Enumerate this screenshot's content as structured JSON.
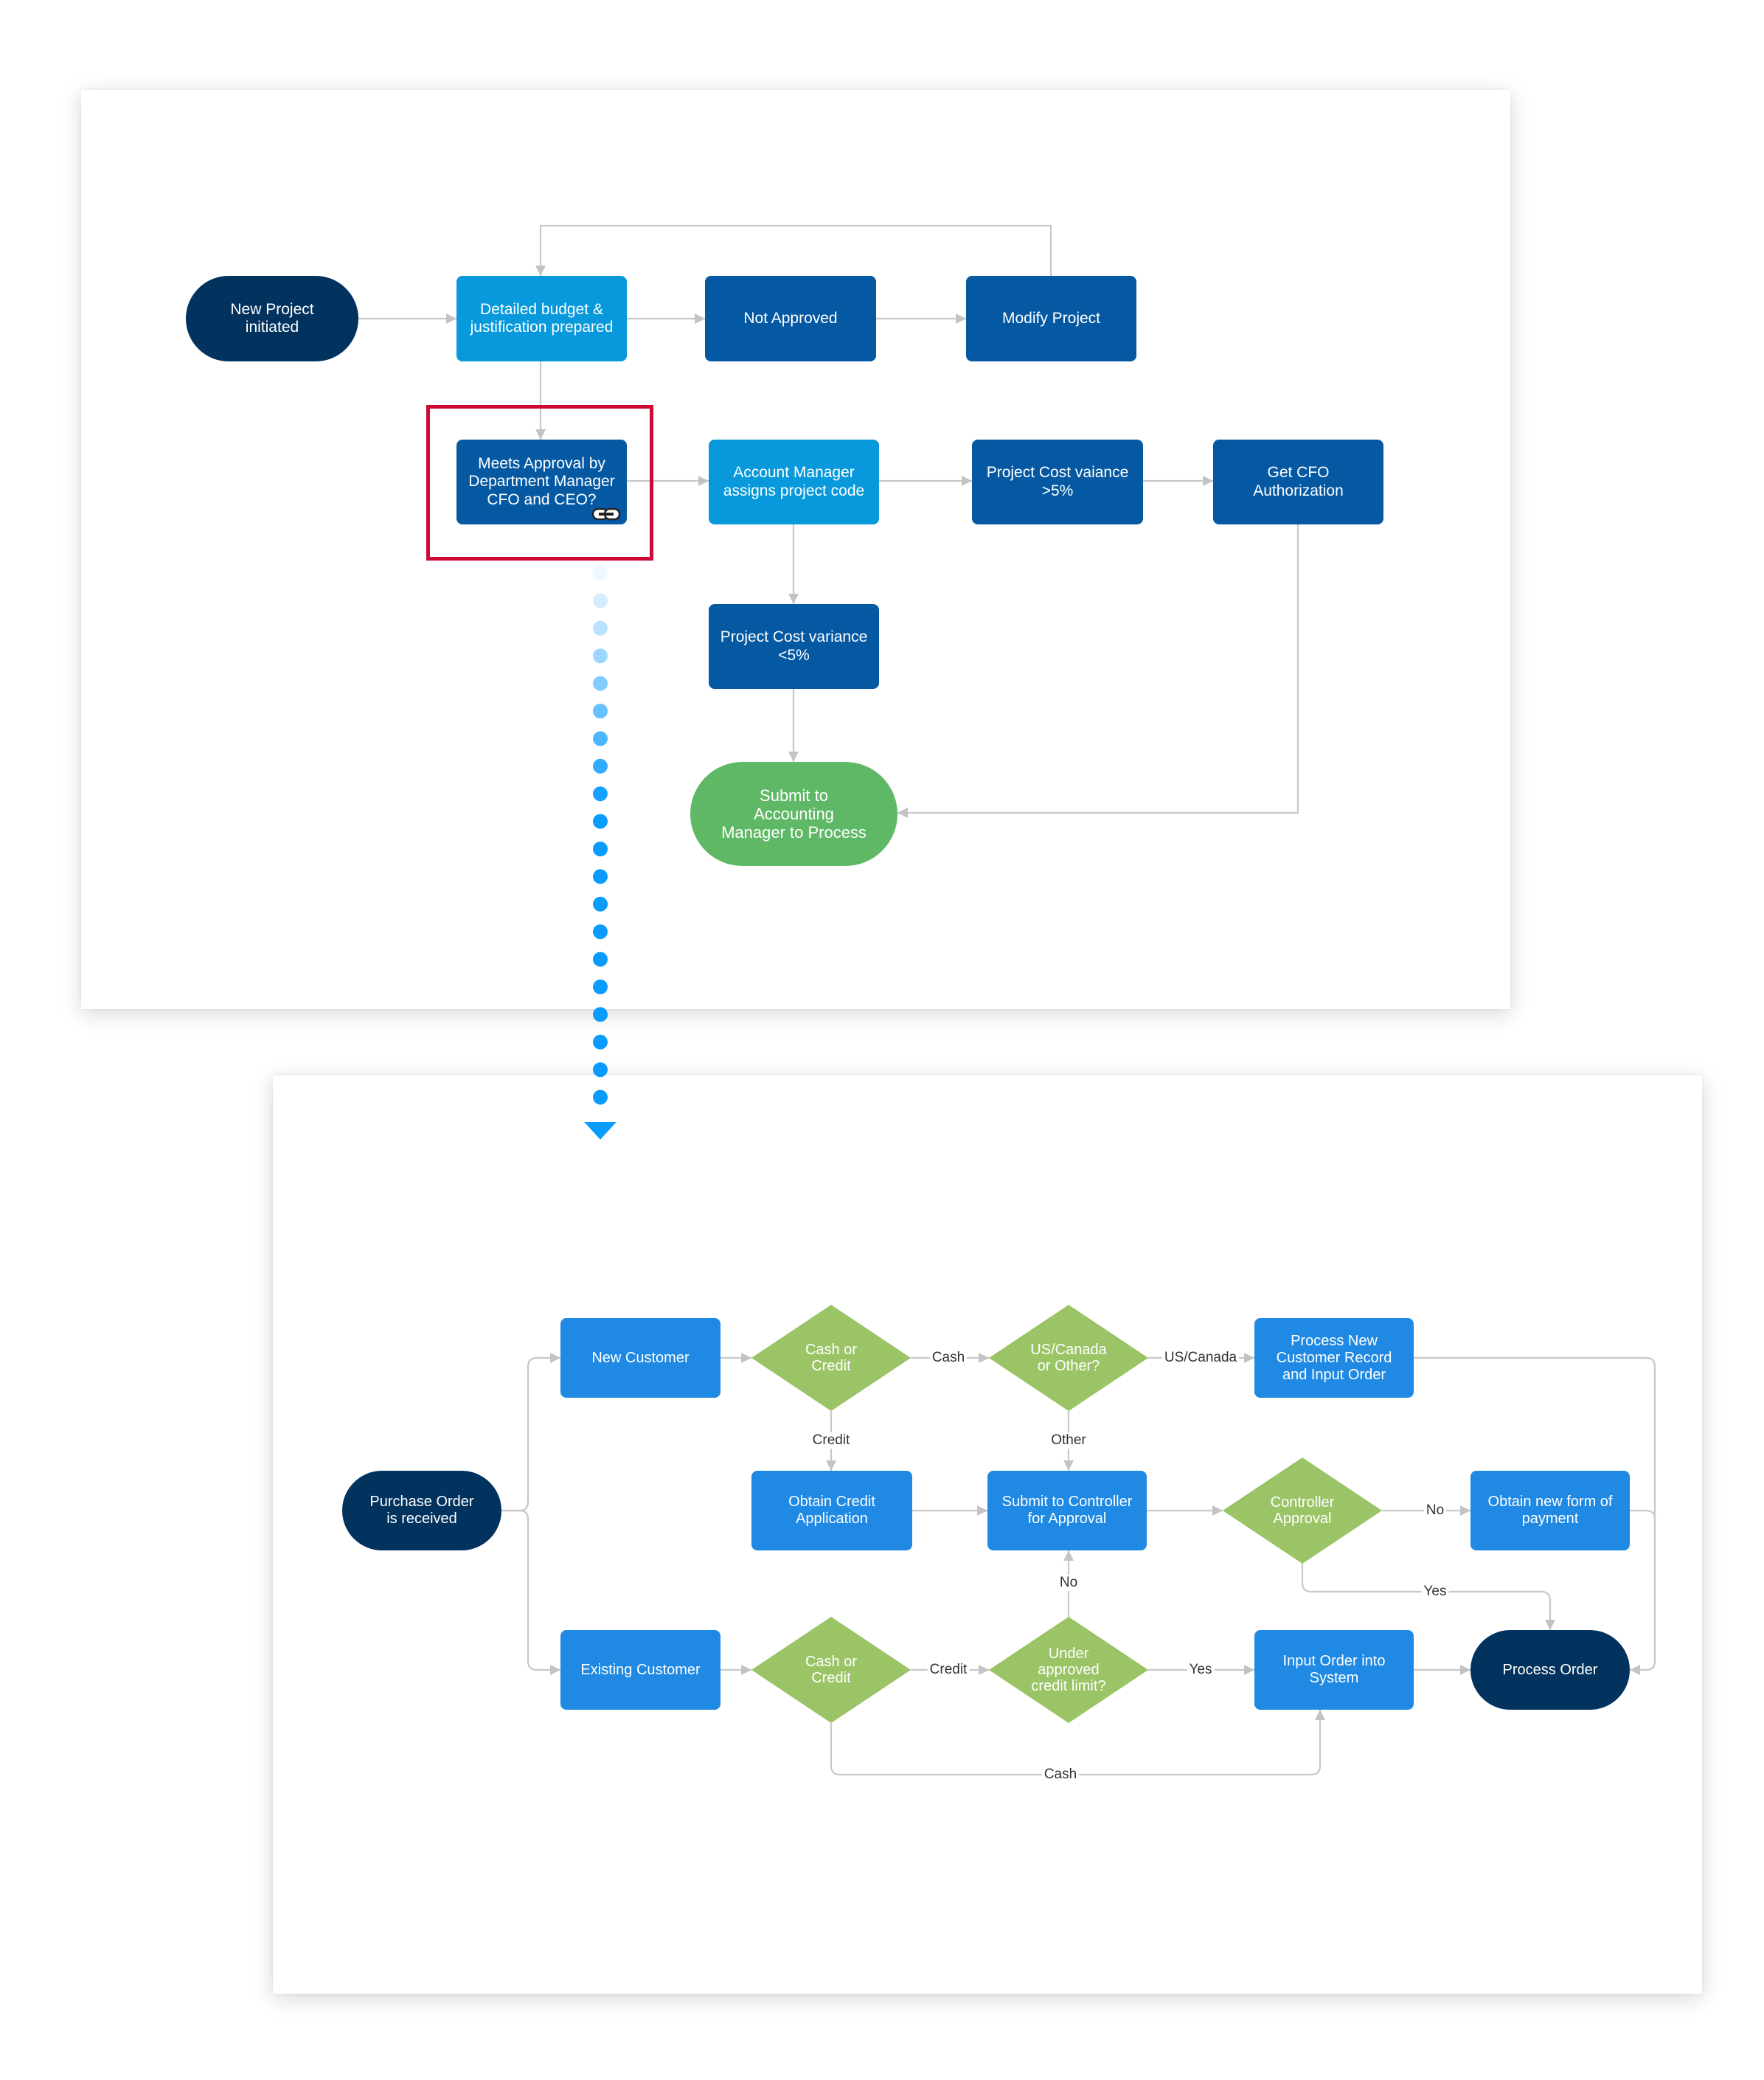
{
  "colors": {
    "light_blue": "#0799dc",
    "dark_blue": "#0559a3",
    "navy": "#02325e",
    "green_terminal": "#5fb866",
    "process_blue": "#1f89e3",
    "decision_green": "#9bc466",
    "connector_gray": "#c3c3c3",
    "highlight_red": "#cc0a33",
    "dotted_link_blue": "#0a9bff"
  },
  "top_diagram": {
    "nodes": {
      "new_project": "New Project\ninitiated",
      "detailed_budget": "Detailed budget &\njustification prepared",
      "not_approved": "Not Approved",
      "modify_project": "Modify Project",
      "meets_approval": "Meets Approval by\nDepartment Manager\nCFO and CEO?",
      "account_manager": "Account Manager\nassigns project code",
      "cost_variance_gt": "Project Cost vaiance\n>5%",
      "cfo_authorization": "Get CFO Authorization",
      "cost_variance_lt": "Project Cost variance\n<5%",
      "submit_accounting": "Submit to\nAccounting\nManager to Process"
    },
    "link_icon": "chain-link-icon",
    "highlighted_node": "meets_approval"
  },
  "bottom_diagram": {
    "nodes": {
      "purchase_order": "Purchase Order\nis received",
      "new_customer": "New Customer",
      "cash_or_credit_new": "Cash or\nCredit",
      "us_canada_or_other": "US/Canada\nor Other?",
      "process_new_customer": "Process New\nCustomer Record\nand Input Order",
      "obtain_credit_app": "Obtain Credit\nApplication",
      "submit_controller": "Submit to Controller\nfor Approval",
      "controller_approval": "Controller\nApproval",
      "obtain_new_payment": "Obtain new form of\npayment",
      "existing_customer": "Existing Customer",
      "cash_or_credit_existing": "Cash or\nCredit",
      "under_credit_limit": "Under\napproved\ncredit limit?",
      "input_order": "Input Order into\nSystem",
      "process_order": "Process Order"
    },
    "edge_labels": {
      "cash_1": "Cash",
      "us_canada": "US/Canada",
      "credit_1": "Credit",
      "other": "Other",
      "no_controller": "No",
      "yes_controller": "Yes",
      "no_credit_limit": "No",
      "credit_2": "Credit",
      "yes_credit_limit": "Yes",
      "cash_2": "Cash"
    }
  }
}
